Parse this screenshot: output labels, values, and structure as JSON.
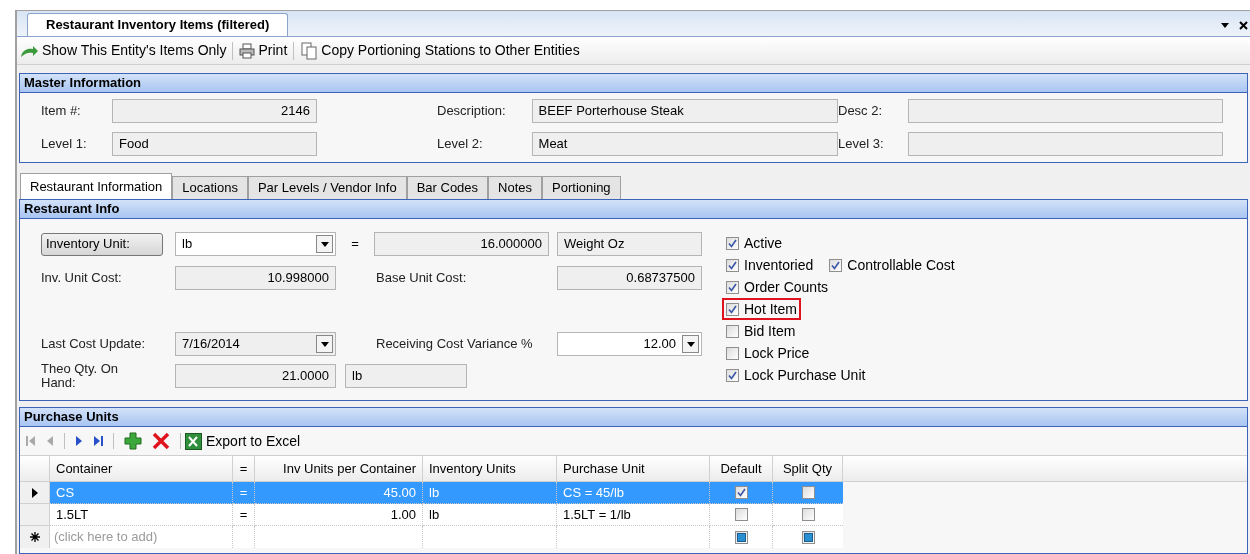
{
  "document_tab": {
    "title": "Restaurant Inventory Items (filtered)"
  },
  "toolbar": [
    "Show This Entity's Items Only",
    "Print",
    "Copy Portioning Stations to Other Entities"
  ],
  "master_information": {
    "title": "Master Information",
    "fields": [
      {
        "label": "Item #:",
        "value": "2146"
      },
      {
        "label": "Description:",
        "value": "BEEF Porterhouse Steak"
      },
      {
        "label": "Desc 2:"
      },
      {
        "label": "Level 1:",
        "value": "Food"
      },
      {
        "label": "Level 2:",
        "value": "Meat"
      },
      {
        "label": "Level 3:"
      }
    ]
  },
  "tabs": [
    {
      "label": "Restaurant Information",
      "selected": true
    },
    {
      "label": "Locations",
      "selected": false
    },
    {
      "label": "Par Levels / Vendor Info",
      "selected": false
    },
    {
      "label": "Bar Codes",
      "selected": false
    },
    {
      "label": "Notes",
      "selected": false
    },
    {
      "label": "Portioning",
      "selected": false
    }
  ],
  "restaurant_info": {
    "title": "Restaurant Info",
    "inventory_unit": {
      "button": "Inventory Unit:",
      "value": "lb"
    },
    "equals": "=",
    "conversion": "16.000000",
    "conversion_unit": "Weight Oz",
    "inv_unit_cost": {
      "label": "Inv. Unit Cost:",
      "value": "10.998000"
    },
    "base_unit_cost": {
      "label": "Base Unit Cost:",
      "value": "0.68737500"
    },
    "last_cost_update": {
      "label": "Last Cost Update:",
      "value": "7/16/2014"
    },
    "receiving_cost_variance": {
      "label": "Receiving Cost Variance %",
      "value": "12.00"
    },
    "theo_qty": {
      "label": "Theo Qty. On Hand:",
      "value": "21.0000",
      "unit": "lb"
    },
    "checkbox_rows": [
      [
        {
          "label": "Active",
          "checked": true,
          "highlighted": false
        }
      ],
      [
        {
          "label": "Inventoried",
          "checked": true,
          "highlighted": false
        },
        {
          "label": "Controllable Cost",
          "checked": true,
          "highlighted": false
        }
      ],
      [
        {
          "label": "Order Counts",
          "checked": true,
          "highlighted": false
        }
      ],
      [
        {
          "label": "Hot Item",
          "checked": true,
          "highlighted": true
        }
      ],
      [
        {
          "label": "Bid Item",
          "checked": false,
          "highlighted": false
        }
      ],
      [
        {
          "label": "Lock Price",
          "checked": false,
          "highlighted": false
        }
      ],
      [
        {
          "label": "Lock Purchase Unit",
          "checked": true,
          "highlighted": false
        }
      ]
    ]
  },
  "purchase_units": {
    "title": "Purchase Units",
    "export": "Export to Excel",
    "columns": [
      "Container",
      "=",
      "Inv Units per Container",
      "Inventory Units",
      "Purchase Unit",
      "Default",
      "Split Qty"
    ],
    "rows": [
      {
        "selected": true,
        "container": "CS",
        "eq": "=",
        "per_container": "45.00",
        "inventory_units": "lb",
        "purchase_unit": "CS = 45/lb",
        "default": true,
        "split_qty": false
      },
      {
        "selected": false,
        "container": "1.5LT",
        "eq": "=",
        "per_container": "1.00",
        "inventory_units": "lb",
        "purchase_unit": "1.5LT = 1/lb",
        "default": false,
        "split_qty": false
      }
    ],
    "new_row": {
      "placeholder": "(click here to add)",
      "default_indeterminate": true,
      "split_qty_indeterminate": true
    }
  }
}
